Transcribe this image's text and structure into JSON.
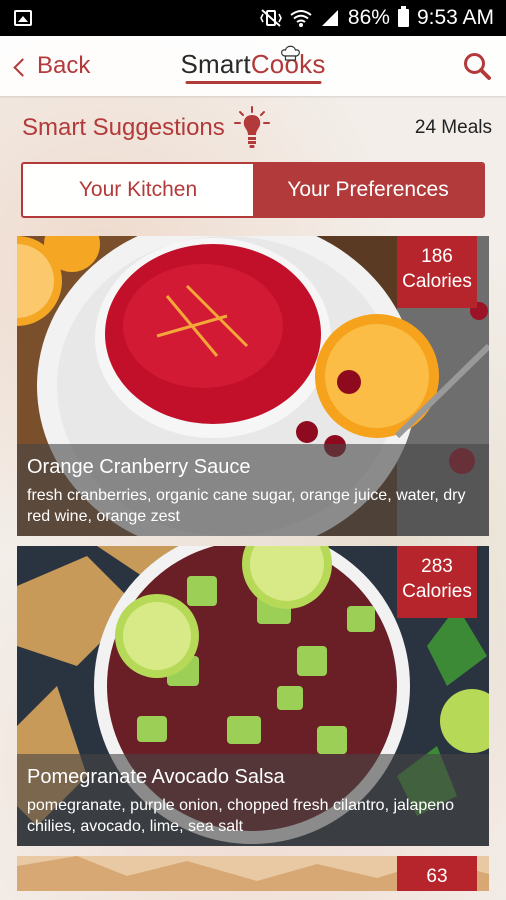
{
  "status_bar": {
    "battery": "86%",
    "time": "9:53 AM"
  },
  "header": {
    "back_label": "Back",
    "logo_part1": "Smart",
    "logo_part2": "Cooks"
  },
  "suggestions": {
    "title": "Smart Suggestions",
    "meal_count": "24 Meals"
  },
  "tabs": [
    {
      "label": "Your Kitchen",
      "active": false
    },
    {
      "label": "Your Preferences",
      "active": true
    }
  ],
  "recipes": [
    {
      "title": "Orange Cranberry Sauce",
      "ingredients": "fresh cranberries, organic cane sugar, orange juice, water, dry red wine, orange zest",
      "calories_value": "186",
      "calories_label": "Calories"
    },
    {
      "title": "Pomegranate Avocado Salsa",
      "ingredients": "pomegranate, purple onion, chopped fresh cilantro, jalapeno chilies, avocado, lime, sea salt",
      "calories_value": "283",
      "calories_label": "Calories"
    },
    {
      "calories_value": "63"
    }
  ],
  "colors": {
    "accent": "#b23a3a",
    "badge": "#b7252c"
  }
}
